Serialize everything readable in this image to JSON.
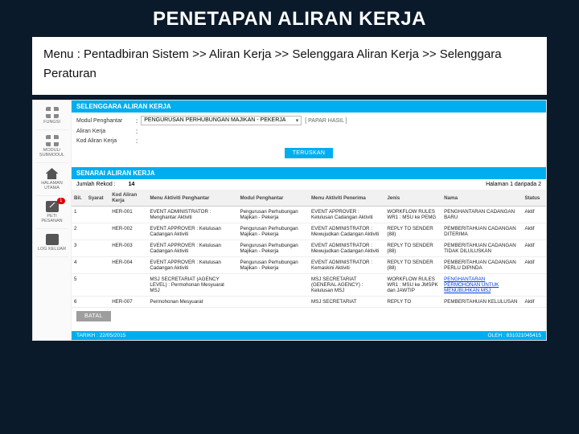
{
  "title": "PENETAPAN ALIRAN KERJA",
  "breadcrumb": "Menu : Pentadbiran Sistem >> Aliran Kerja >> Selenggara Aliran Kerja >> Selenggara Peraturan",
  "sidebar": {
    "items": [
      {
        "label": "FUNGSI"
      },
      {
        "label": "MODUL/ SUBMODUL"
      },
      {
        "label": "HALAMAN UTAMA"
      },
      {
        "label": "PETI PESANAN",
        "badge": "1"
      },
      {
        "label": "LOG KELUAR"
      }
    ]
  },
  "panel": {
    "header": "SELENGGARA ALIRAN KERJA"
  },
  "form": {
    "labels": {
      "modul": "Modul Penghantar",
      "aliran": "Aliran Kerja",
      "kod": "Kod Aliran Kerja"
    },
    "modul_value": "PENGURUSAN PERHUBUNGAN MAJIKAN - PEKERJA",
    "papar_hint": "[ PAPAR HASIL ]",
    "teruskan": "TERUSKAN"
  },
  "list": {
    "title": "SENARAI ALIRAN KERJA",
    "jumlah_label": "Jumlah Rekod :",
    "jumlah_value": "14",
    "pager": "Halaman 1 daripada 2",
    "columns": {
      "bil": "Bil.",
      "syarat": "Syarat",
      "kod": "Kod Aliran Kerja",
      "aktiviti_penghantar": "Menu Aktiviti Penghantar",
      "modul_penghantar": "Modul Penghantar",
      "aktiviti_penerima": "Menu Aktiviti Penerima",
      "jenis": "Jenis",
      "nama": "Nama",
      "status": "Status"
    },
    "rows": [
      {
        "bil": "1",
        "kod": "HER-001",
        "aktiviti": "EVENT ADMINISTRATOR : Menghantar Aktiviti",
        "modul": "Pengurusan Perhubungan Majikan - Pekerja",
        "penerima": "EVENT APPROVER : Kelulusan Cadangan Aktiviti",
        "jenis": "WORKFLOW RULES WR1 : MSU ke PEMG",
        "nama": "PENGHANTARAN CADANGAN BARU",
        "status": "Aktif"
      },
      {
        "bil": "2",
        "kod": "HER-002",
        "aktiviti": "EVENT APPROVER : Kelulusan Cadangan Aktiviti",
        "modul": "Pengurusan Perhubungan Majikan - Pekerja",
        "penerima": "EVENT ADMINISTRATOR : Mewujudkan Cadangan Aktiviti",
        "jenis": "REPLY TO SENDER (88)",
        "nama": "PEMBERITAHUAN CADANGAN DITERIMA",
        "status": "Aktif"
      },
      {
        "bil": "3",
        "kod": "HER-003",
        "aktiviti": "EVENT APPROVER : Kelulusan Cadangan Aktiviti",
        "modul": "Pengurusan Perhubungan Majikan - Pekerja",
        "penerima": "EVENT ADMINISTRATOR : Mewujudkan Cadangan Aktiviti",
        "jenis": "REPLY TO SENDER (88)",
        "nama": "PEMBERITAHUAN CADANGAN TIDAK DILULUSKAN",
        "status": "Aktif"
      },
      {
        "bil": "4",
        "kod": "HER-004",
        "aktiviti": "EVENT APPROVER : Kelulusan Cadangan Aktiviti",
        "modul": "Pengurusan Perhubungan Majikan - Pekerja",
        "penerima": "EVENT ADMINISTRATOR : Kemaskini Aktiviti",
        "jenis": "REPLY TO SENDER (88)",
        "nama": "PEMBERITAHUAN CADANGAN PERLU DIPINDA",
        "status": "Aktif"
      },
      {
        "bil": "5",
        "kod": "",
        "aktiviti": "MSJ SECRETARIAT (AGENCY LEVEL) : Permohonan Mesyuarat MSJ",
        "modul": "",
        "penerima": "MSJ SECRETARIAT (GENERAL AGENCY) : Kelulusan MSJ",
        "jenis": "WORKFLOW RULES WR1 : MSU ke JMSPK dan JAWTIP",
        "nama": "PENGHANTARAN PERMOHONAN UNTUK MENUBUHKAN MSJ",
        "status": ""
      },
      {
        "bil": "6",
        "kod": "HER-007",
        "aktiviti": "Permohonan Mesyuarat",
        "modul": "",
        "penerima": "MSJ SECRETARIAT",
        "jenis": "REPLY TO",
        "nama": "PEMBERITAHUAN KELULUSAN",
        "status": "Aktif"
      }
    ],
    "batal": "BATAL"
  },
  "footer": {
    "left": "TARIKH : 22/05/2015",
    "right": "OLEH : 831021045415"
  }
}
